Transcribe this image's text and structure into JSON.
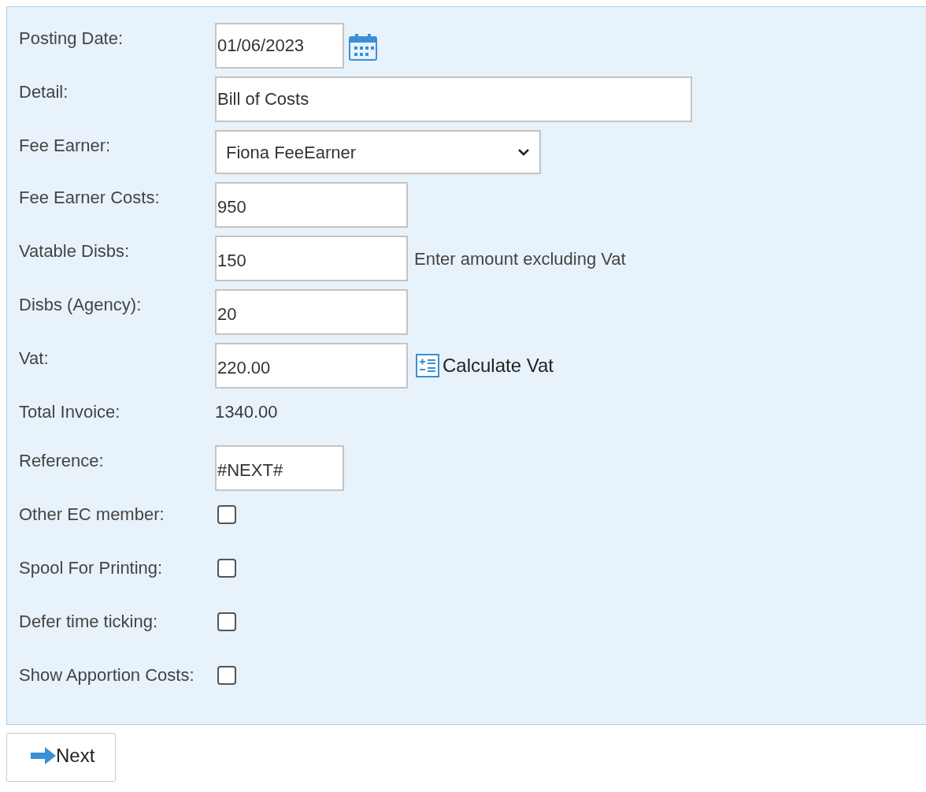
{
  "form": {
    "rows": [
      {
        "label": "Posting Date:",
        "kind": "date",
        "value": "01/06/2023"
      },
      {
        "label": "Detail:",
        "kind": "wide-text",
        "value": "Bill of Costs"
      },
      {
        "label": "Fee Earner:",
        "kind": "select",
        "value": "Fiona FeeEarner"
      },
      {
        "label": "Fee Earner Costs:",
        "kind": "amount",
        "value": "950"
      },
      {
        "label": "Vatable Disbs:",
        "kind": "amount",
        "value": "150",
        "note": "Enter amount excluding Vat"
      },
      {
        "label": "Disbs (Agency):",
        "kind": "amount",
        "value": "20"
      },
      {
        "label": "Vat:",
        "kind": "amount",
        "value": "220.00",
        "action": "Calculate Vat"
      },
      {
        "label": "Total Invoice:",
        "kind": "static",
        "value": "1340.00"
      },
      {
        "label": "Reference:",
        "kind": "short-text",
        "value": "#NEXT#"
      },
      {
        "label": "Other EC member:",
        "kind": "checkbox",
        "checked": false
      },
      {
        "label": "Spool For Printing:",
        "kind": "checkbox",
        "checked": false
      },
      {
        "label": "Defer time ticking:",
        "kind": "checkbox",
        "checked": false
      },
      {
        "label": "Show Apportion Costs:",
        "kind": "checkbox",
        "checked": false
      }
    ]
  },
  "next_button": {
    "label": "Next"
  }
}
